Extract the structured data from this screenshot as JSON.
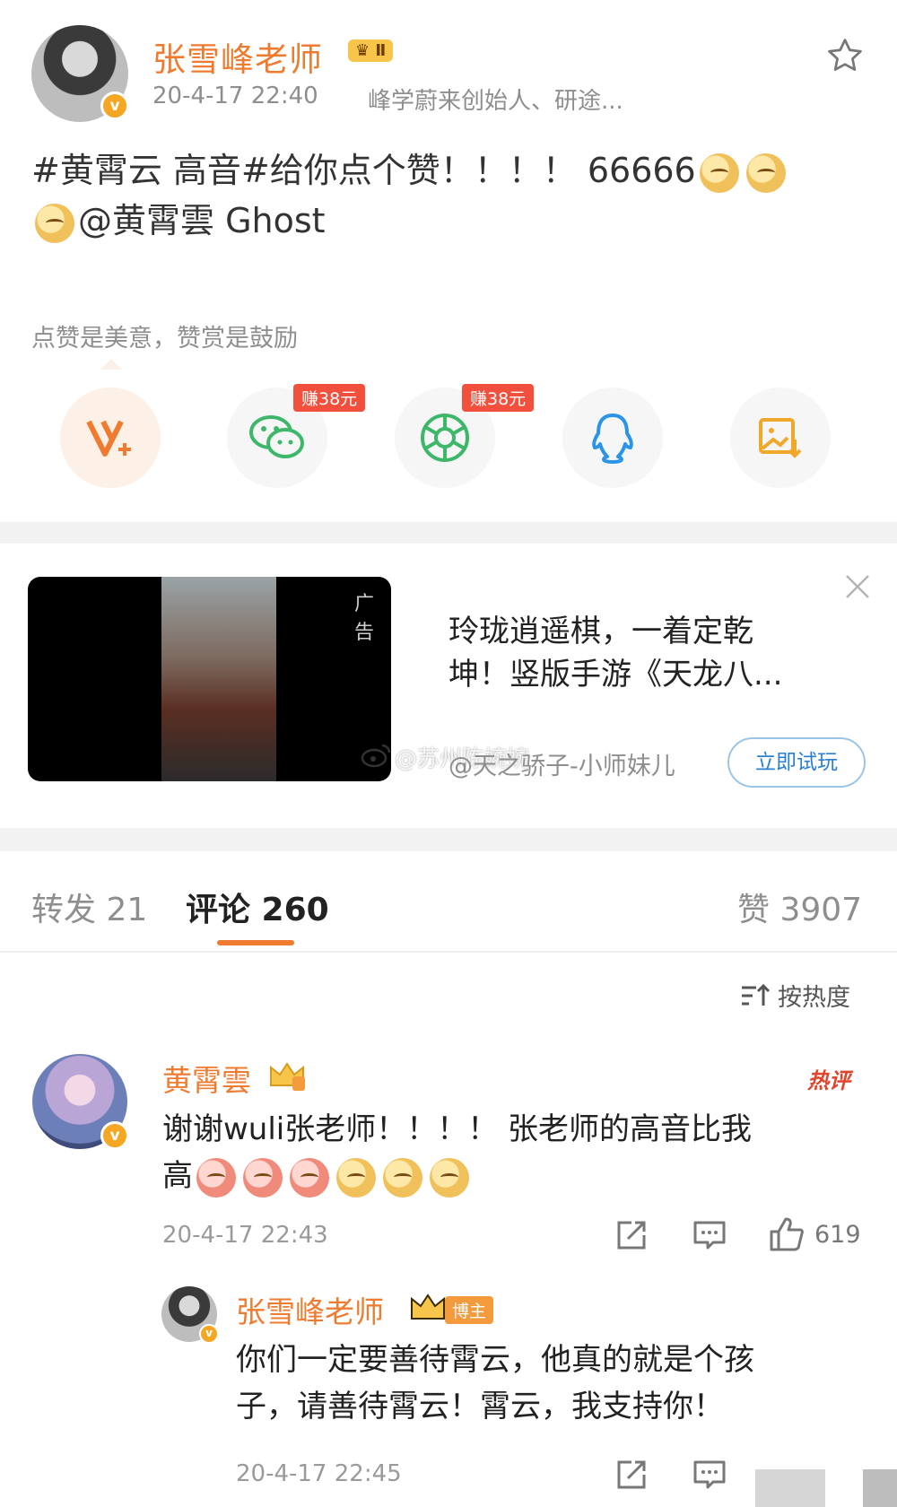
{
  "post": {
    "author": "张雪峰老师",
    "level_badge": "Ⅱ",
    "time": "20-4-17 22:40",
    "bio": "峰学蔚来创始人、研途...",
    "text_line1_pre": "#黄霄云 高音#给你点个赞！！！！ 66666",
    "text_line2_mention": "@黄霄雲 Ghost",
    "appreciate_text": "点赞是美意，赞赏是鼓励",
    "share": {
      "earn_tag_1": "赚38元",
      "earn_tag_2": "赚38元"
    }
  },
  "ad": {
    "tag": "广告",
    "title_line1": "玲珑逍遥棋，一着定乾",
    "title_line2": "坤！竖版手游《天龙八...",
    "author": "@天之骄子-小师妹儿",
    "cta": "立即试玩",
    "watermark": "@苏州陈婉婉"
  },
  "tabs": {
    "repost": "转发 21",
    "comments": "评论 260",
    "likes": "赞 3907"
  },
  "sort_label": "按热度",
  "comments": [
    {
      "name": "黄霄雲",
      "hot": "热评",
      "text_line1": "谢谢wuli张老师！！！！ 张老师的高音比我",
      "text_line2": "高",
      "time": "20-4-17 22:43",
      "likes": "619"
    },
    {
      "name": "张雪峰老师",
      "owner_tag": "博主",
      "text_line1": "你们一定要善待霄云，他真的就是个孩",
      "text_line2": "子，请善待霄云！霄云，我支持你！",
      "time": "20-4-17 22:45"
    }
  ],
  "colors": {
    "accent": "#ee7b2f",
    "hot": "#e0442c",
    "link": "#2b7fcf"
  },
  "icons": [
    "star-icon",
    "vip-plus-icon",
    "wechat-icon",
    "moments-icon",
    "qq-icon",
    "save-image-icon",
    "close-icon",
    "weibo-icon",
    "sort-icon",
    "repost-icon",
    "comment-icon",
    "like-icon"
  ]
}
